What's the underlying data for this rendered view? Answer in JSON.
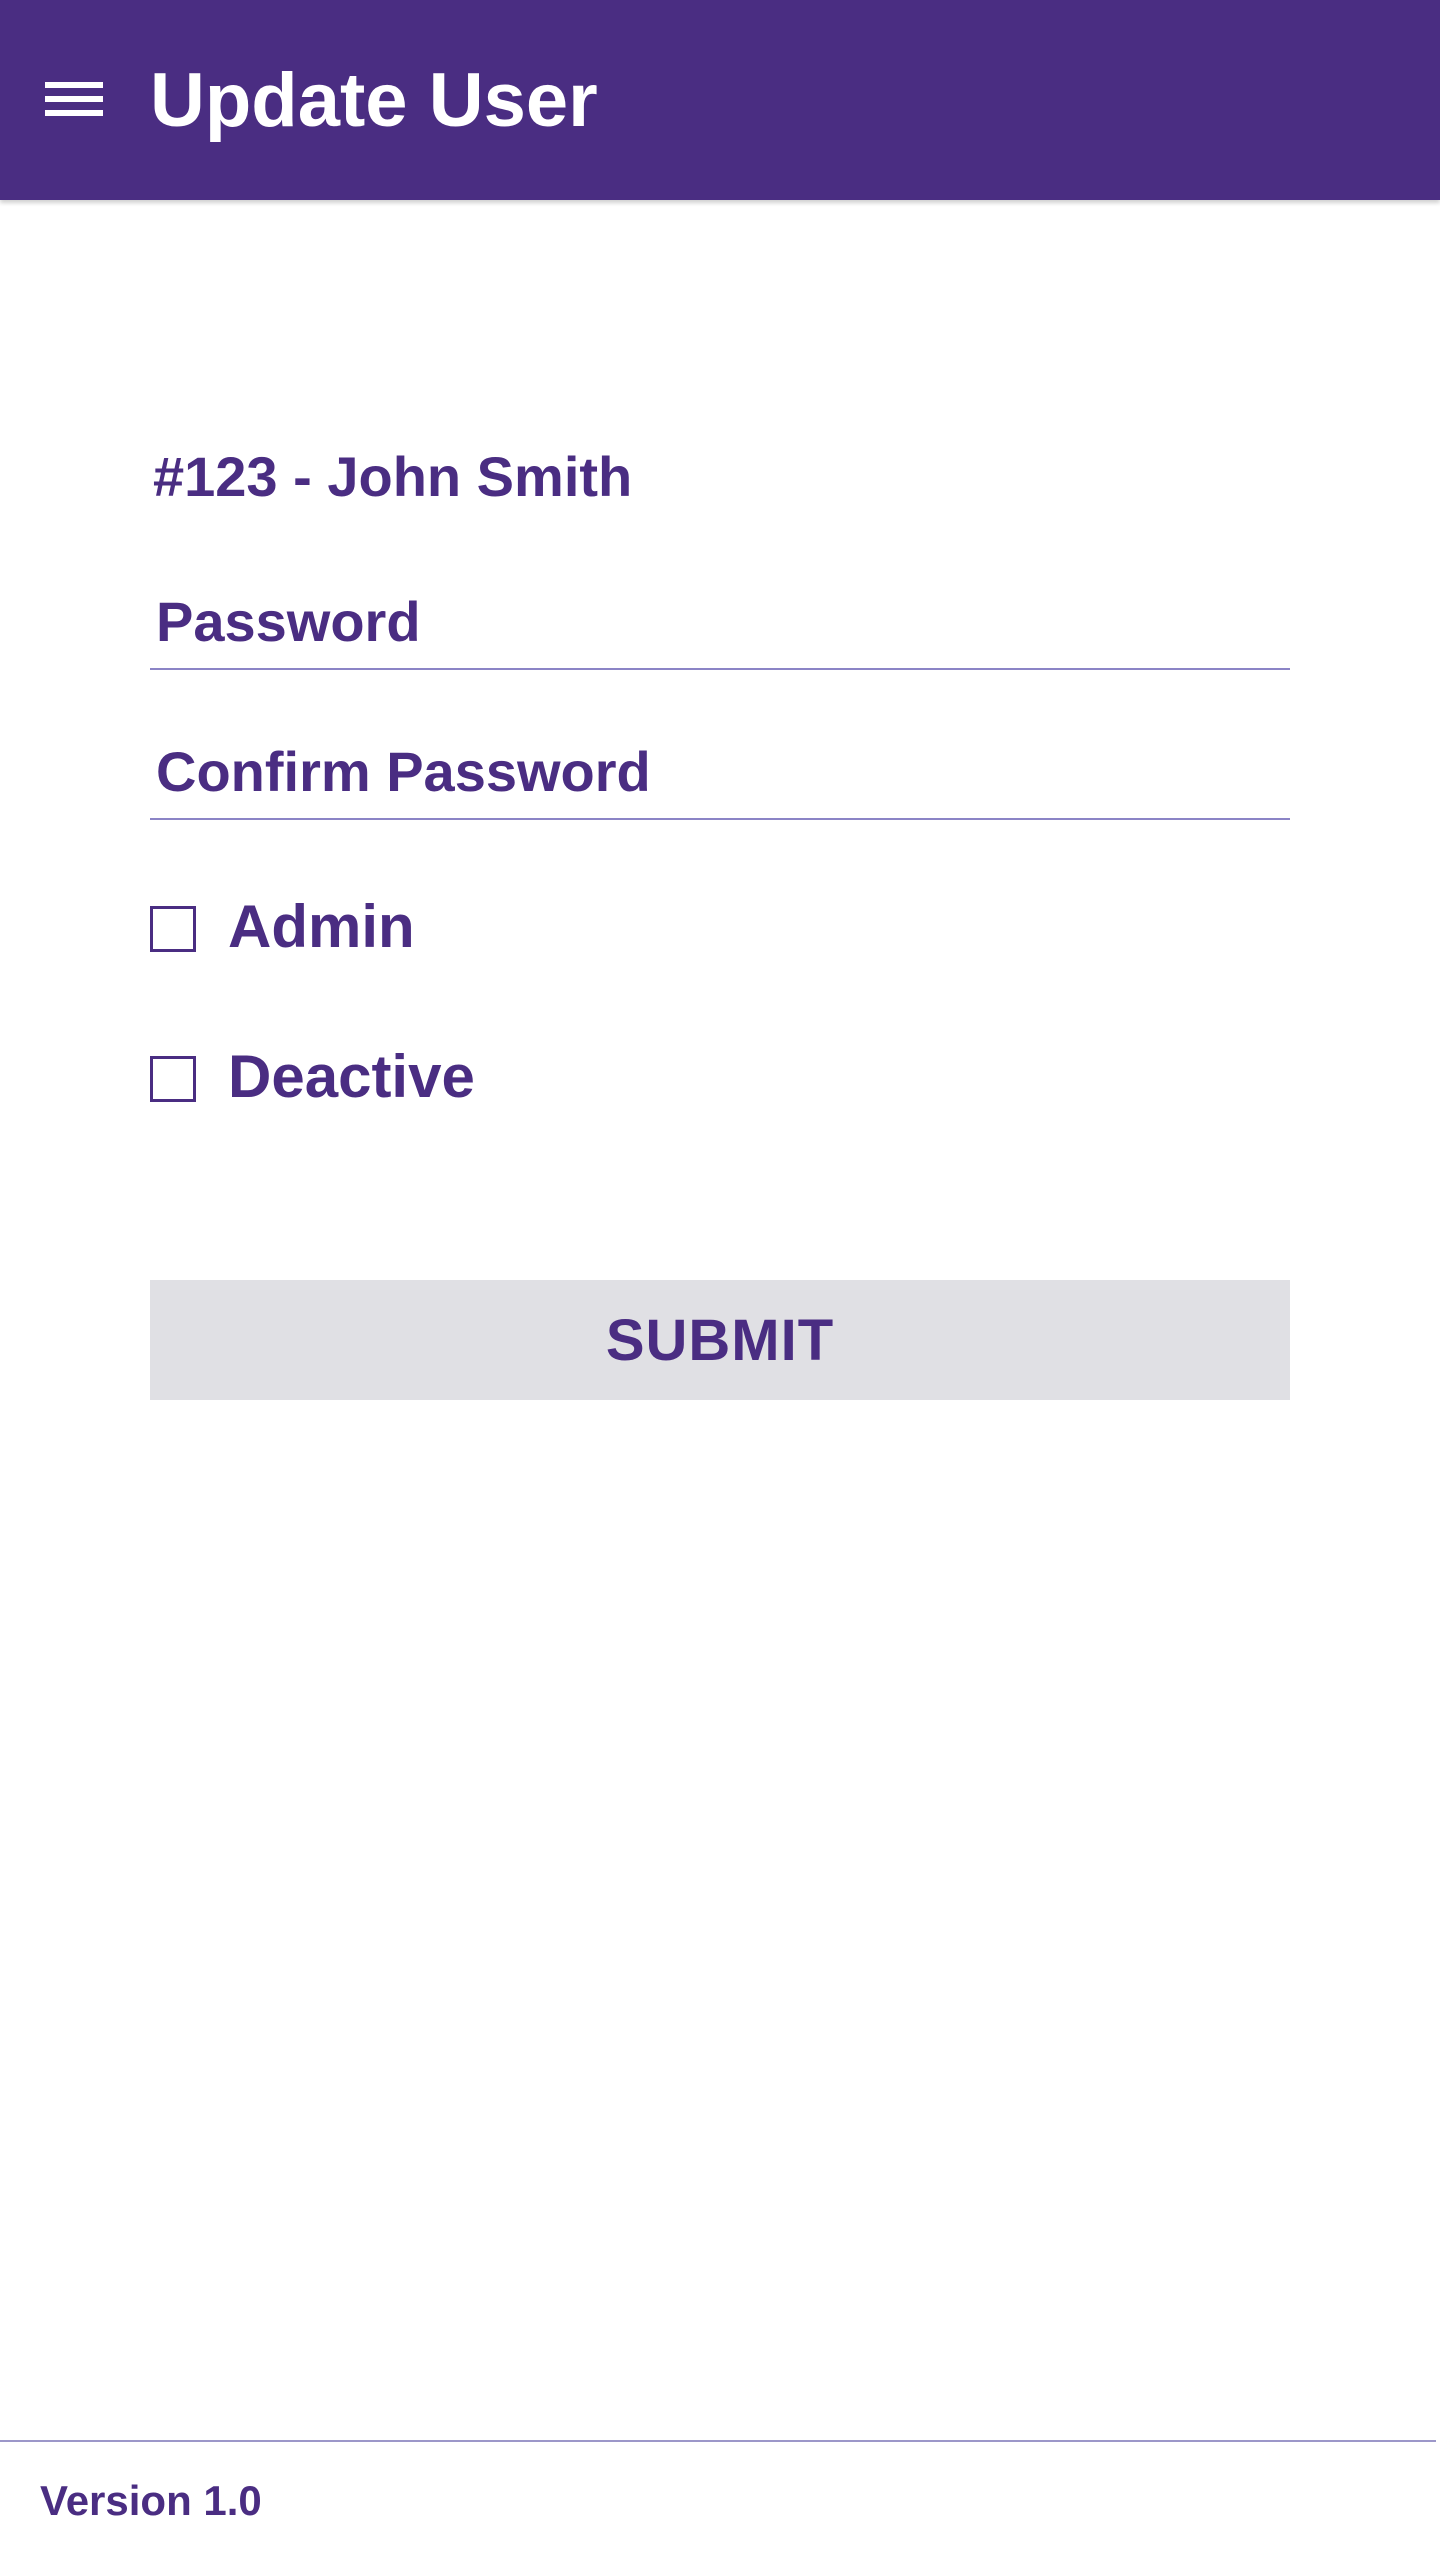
{
  "appbar": {
    "title": "Update User",
    "menu_icon": "hamburger-menu-icon",
    "background_color": "#4a2d82"
  },
  "form": {
    "user_heading": "#123 - John Smith",
    "password": {
      "placeholder": "Password",
      "value": ""
    },
    "confirm_password": {
      "placeholder": "Confirm Password",
      "value": ""
    },
    "checkboxes": [
      {
        "label": "Admin",
        "checked": false
      },
      {
        "label": "Deactive",
        "checked": false
      }
    ],
    "submit_label": "SUBMIT"
  },
  "footer": {
    "version": "Version 1.0"
  },
  "colors": {
    "accent": "#4a2d82",
    "divider": "#8b84c6",
    "button_background": "#e0e0e4",
    "surface": "#ffffff"
  }
}
